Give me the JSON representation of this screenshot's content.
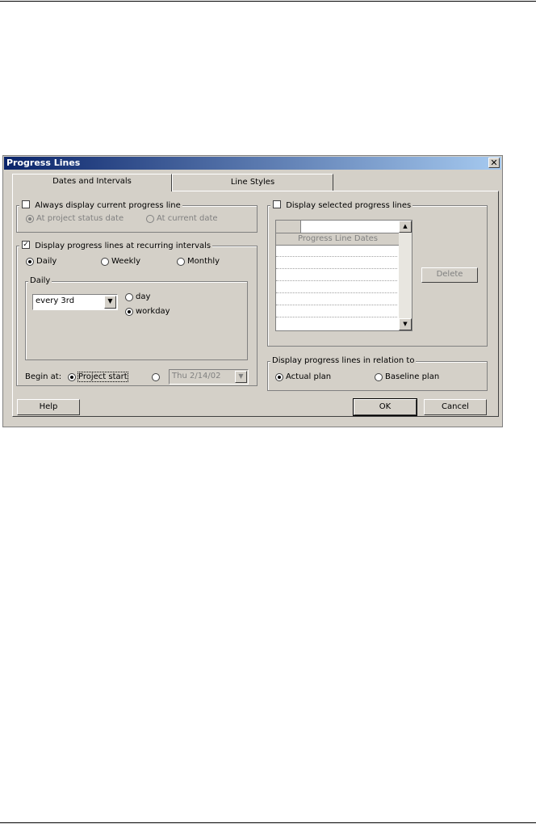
{
  "dialog": {
    "title": "Progress Lines",
    "tabs": [
      {
        "label": "Dates and Intervals",
        "active": true
      },
      {
        "label": "Line Styles",
        "active": false
      }
    ]
  },
  "current_line": {
    "checkbox_label": "Always display current progress line",
    "checked": false,
    "options": [
      "At project status date",
      "At current date"
    ],
    "selected": "At project status date"
  },
  "recurring": {
    "checkbox_label": "Display progress lines at recurring intervals",
    "checked": true,
    "frequency_options": [
      "Daily",
      "Weekly",
      "Monthly"
    ],
    "selected_frequency": "Daily",
    "daily_group_label": "Daily",
    "daily_interval": "every 3rd",
    "unit_options": [
      "day",
      "workday"
    ],
    "selected_unit": "workday",
    "begin_at_label": "Begin at:",
    "begin_options": [
      "Project start"
    ],
    "selected_begin": "Project start",
    "begin_date": "Thu 2/14/02"
  },
  "selected_lines": {
    "checkbox_label": "Display selected progress lines",
    "checked": false,
    "list_header": "Progress Line Dates",
    "delete_label": "Delete"
  },
  "relation": {
    "group_label": "Display progress lines in relation to",
    "options": [
      "Actual plan",
      "Baseline plan"
    ],
    "selected": "Actual plan"
  },
  "buttons": {
    "help": "Help",
    "ok": "OK",
    "cancel": "Cancel"
  }
}
